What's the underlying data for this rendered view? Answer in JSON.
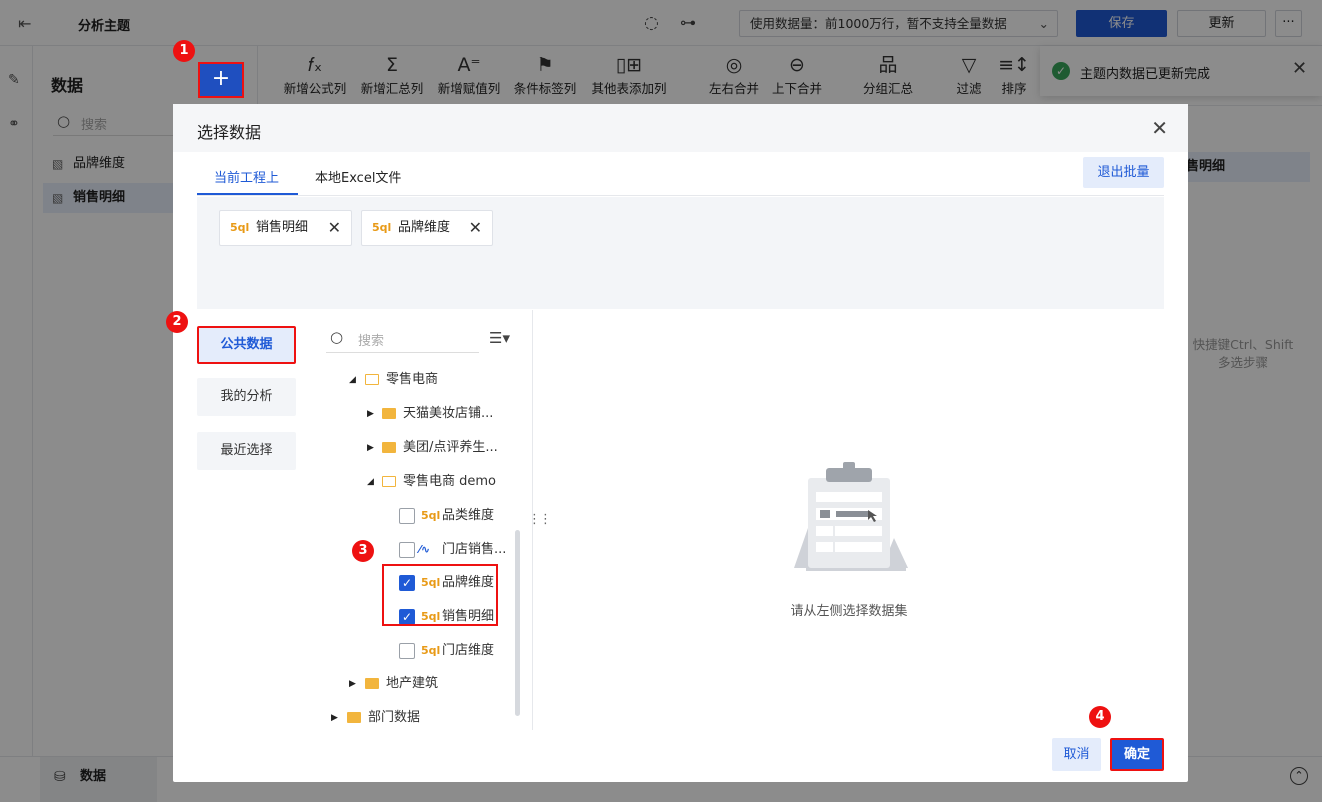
{
  "topbar": {
    "title": "分析主题",
    "usage_label": "使用数据量：前1000万行，暂不支持全量数据",
    "save_label": "保存",
    "update_label": "更新",
    "more_label": "···"
  },
  "data_panel": {
    "header": "数据",
    "search_placeholder": "搜索",
    "items": [
      {
        "label": "品牌维度",
        "selected": false
      },
      {
        "label": "销售明细",
        "selected": true
      }
    ],
    "add_label": "+"
  },
  "toolbar": {
    "tools": [
      {
        "icon": "fx",
        "label": "新增公式列"
      },
      {
        "icon": "Σ",
        "label": "新增汇总列"
      },
      {
        "icon": "A=",
        "label": "新增赋值列"
      },
      {
        "icon": "flag",
        "label": "条件标签列"
      },
      {
        "icon": "plus-grid",
        "label": "其他表添加列"
      },
      {
        "icon": "merge-lr",
        "label": "左右合并"
      },
      {
        "icon": "merge-ud",
        "label": "上下合并"
      },
      {
        "icon": "group",
        "label": "分组汇总"
      },
      {
        "icon": "filter",
        "label": "过滤"
      },
      {
        "icon": "sort",
        "label": "排序"
      }
    ]
  },
  "toast": {
    "message": "主题内数据已更新完成"
  },
  "right_panel": {
    "selected_label": "售明细",
    "hint": "快捷键Ctrl、Shift多选步骤"
  },
  "bottombar": {
    "tab_label": "数据"
  },
  "modal": {
    "title": "选择数据",
    "tabs": [
      "当前工程上",
      "本地Excel文件"
    ],
    "exit_batch_label": "退出批量",
    "chips": [
      {
        "label": "销售明细",
        "icon": "sql"
      },
      {
        "label": "品牌维度",
        "icon": "sql"
      }
    ],
    "categories": [
      "公共数据",
      "我的分析",
      "最近选择"
    ],
    "tree_search_placeholder": "搜索",
    "tree": [
      {
        "label": "零售电商",
        "type": "folder",
        "expanded": true
      },
      {
        "label": "天猫美妆店铺...",
        "type": "folder",
        "expanded": false
      },
      {
        "label": "美团/点评养生...",
        "type": "folder",
        "expanded": false
      },
      {
        "label": "零售电商 demo",
        "type": "folder",
        "expanded": true
      },
      {
        "label": "品类维度",
        "type": "sql",
        "checked": false
      },
      {
        "label": "门店销售...",
        "type": "line",
        "checked": false
      },
      {
        "label": "品牌维度",
        "type": "sql",
        "checked": true
      },
      {
        "label": "销售明细",
        "type": "sql",
        "checked": true
      },
      {
        "label": "门店维度",
        "type": "sql",
        "checked": false
      },
      {
        "label": "地产建筑",
        "type": "folder",
        "expanded": false
      },
      {
        "label": "部门数据",
        "type": "folder",
        "expanded": false
      }
    ],
    "empty_message": "请从左侧选择数据集",
    "cancel_label": "取消",
    "ok_label": "确定"
  },
  "badges": [
    "1",
    "2",
    "3",
    "4"
  ],
  "colors": {
    "primary": "#1f5ad6",
    "highlight": "#ee1111",
    "sql_icon": "#e89a17",
    "folder": "#f2b53d"
  }
}
